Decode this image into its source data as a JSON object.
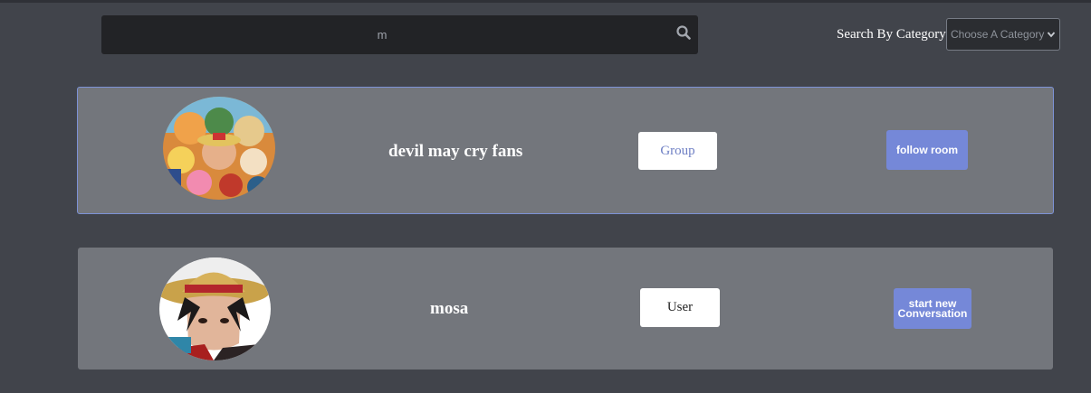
{
  "search": {
    "value": "m"
  },
  "category_filter": {
    "label": "Search By Category:",
    "selected": "Choose A Category"
  },
  "results": [
    {
      "name": "devil may cry fans",
      "type": "Group",
      "action": "follow room",
      "avatar": "group-avatar-image"
    },
    {
      "name": "mosa",
      "type": "User",
      "action": "start new Conversation",
      "avatar": "user-avatar-image"
    }
  ],
  "colors": {
    "background": "#41444b",
    "card": "#73767c",
    "accent": "#7588d8",
    "selected_border": "#7d92d6"
  }
}
